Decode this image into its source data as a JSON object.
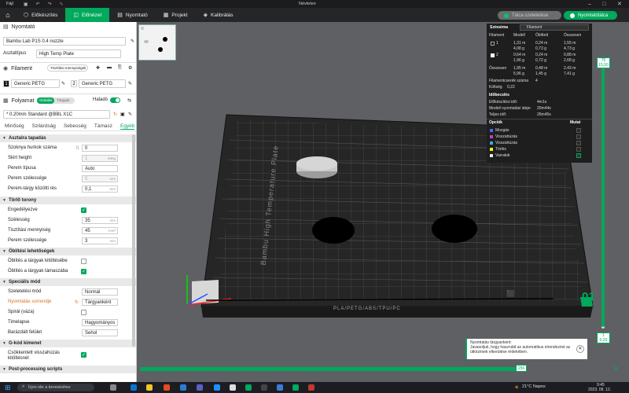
{
  "app": {
    "title": "Névtelen",
    "file_menu": "Fájl"
  },
  "tabs": [
    {
      "label": "Előkészítés",
      "icon": "prepare-icon"
    },
    {
      "label": "Előnézet",
      "icon": "preview-icon"
    },
    {
      "label": "Nyomtató",
      "icon": "printer-icon"
    },
    {
      "label": "Projekt",
      "icon": "project-icon"
    },
    {
      "label": "Kalibrálás",
      "icon": "calibration-icon"
    }
  ],
  "actions": {
    "slice_plate": "Tálca szeletelése",
    "print_plate": "Nyomtatótálca"
  },
  "printer": {
    "section": "Nyomtató",
    "name": "Bambu Lab P1S 0.4 nozzle",
    "plate_label": "Asztaltípus",
    "plate_value": "High Temp Plate"
  },
  "filament": {
    "section": "Filament",
    "flush_button": "Tisztítási mennyiségek",
    "slots": [
      {
        "num": "1",
        "name": "Generic PETG",
        "color": "#111111"
      },
      {
        "num": "2",
        "name": "Generic PETG",
        "color": "#ffffff"
      }
    ]
  },
  "process": {
    "section": "Folyamat",
    "toggle_a": "Globális",
    "toggle_b": "Tárgyak",
    "advanced": "Haladó",
    "preset": "* 0.20mm Standard @BBL X1C"
  },
  "subtabs": [
    "Minőség",
    "Szilárdság",
    "Sebesség",
    "Támasz",
    "Egyéb"
  ],
  "groups": {
    "bed_adhesion": {
      "title": "Asztalra tapadás",
      "rows": [
        {
          "label": "Szoknya hurkok száma",
          "value": "0",
          "unit": ""
        },
        {
          "label": "Skirt height",
          "value": "1",
          "unit": "réteg"
        },
        {
          "label": "Perem típusa",
          "value": "Auto",
          "unit": ""
        },
        {
          "label": "Perem szélessége",
          "value": "5",
          "unit": "mm"
        },
        {
          "label": "Perem-tárgy közötti rés",
          "value": "0,1",
          "unit": "mm"
        }
      ]
    },
    "prime_tower": {
      "title": "Törlő torony",
      "rows": [
        {
          "label": "Engedélyezve",
          "value": "",
          "unit": ""
        },
        {
          "label": "Szélesség",
          "value": "35",
          "unit": "mm"
        },
        {
          "label": "Tisztítási mennyiség",
          "value": "45",
          "unit": "mm³"
        },
        {
          "label": "Perem szélessége",
          "value": "3",
          "unit": "mm"
        }
      ]
    },
    "flush_options": {
      "title": "Öblítési lehetőségek",
      "rows": [
        {
          "label": "Öblítés a tárgyak kitöltésébe",
          "checked": false
        },
        {
          "label": "Öblítés a tárgyak támaszába",
          "checked": true
        }
      ]
    },
    "special_mode": {
      "title": "Speciális mód",
      "rows": [
        {
          "label": "Szeletelési mód",
          "value": "Normál"
        },
        {
          "label": "Nyomtatás sorrendje",
          "value": "Tárgyanként"
        },
        {
          "label": "Spirál (váza)",
          "value": ""
        },
        {
          "label": "Timelapse",
          "value": "Hagyományos"
        },
        {
          "label": "Barázdált felület",
          "value": "Sehol"
        }
      ]
    },
    "gcode_output": {
      "title": "G-kód kimenet",
      "rows": [
        {
          "label": "Csökkentett visszahúzás kitöltésnél",
          "checked": true
        }
      ]
    },
    "post": {
      "title": "Post-processing scripts"
    }
  },
  "stats": {
    "header": "Színséma",
    "dropdown": "Filament",
    "cols": [
      "Filament",
      "Modell",
      "Öblített",
      "Összesen"
    ],
    "rows": [
      {
        "id": "1",
        "model": "1,31 m",
        "model2": "4,08 g",
        "flush": "0,24 m",
        "flush2": "0,73 g",
        "total": "1,55 m",
        "total2": "4,73 g"
      },
      {
        "id": "2",
        "model": "0,64 m",
        "model2": "1,96 g",
        "flush": "0,24 m",
        "flush2": "0,72 g",
        "total": "0,88 m",
        "total2": "2,68 g"
      }
    ],
    "sum": {
      "label": "Összesen",
      "model": "1,95 m",
      "model2": "5,96 g",
      "flush": "0,48 m",
      "flush2": "1,45 g",
      "total": "2,43 m",
      "total2": "7,41 g"
    },
    "changes_label": "Filamentcserék száma",
    "changes": "4",
    "cost_label": "Költség",
    "cost": "0,22",
    "time_header": "Időbecslés",
    "prep_label": "Előkészítési idő:",
    "prep": "4m1s",
    "model_label": "Modell nyomtatási ideje:",
    "model_time": "20m44s",
    "total_label": "Teljes idő:",
    "total": "26m45s",
    "options_header": "Opciók",
    "show_header": "Mutat",
    "options": [
      {
        "label": "Mozgás",
        "color": "#4a6cff"
      },
      {
        "label": "Visszahúzás",
        "color": "#c040c0"
      },
      {
        "label": "Visszahúzás",
        "color": "#3fa9f5"
      },
      {
        "label": "Törlés",
        "color": "#ffff00"
      },
      {
        "label": "Varratok",
        "color": "#e8e8e8"
      }
    ]
  },
  "plate": {
    "label": "Bambu High Temperature Plate",
    "number": "01",
    "footer": "PLA/PETG/ABS/TPU/PC"
  },
  "layers": {
    "top_num": "75",
    "top_h": "15,00",
    "bottom_num": "1",
    "bottom_h": "0,20",
    "h_value": "256"
  },
  "notification": {
    "title": "Nyomtatás tárgyanként:",
    "body": "Javasoljuk, hogy használd az automatikus elrendezést az ütközések elkerülése érdekében."
  },
  "taskbar": {
    "search": "Írjon ide a kereséshez",
    "weather": "21°C  Napos",
    "time": "9:45",
    "date": "2023. 09. 12."
  }
}
